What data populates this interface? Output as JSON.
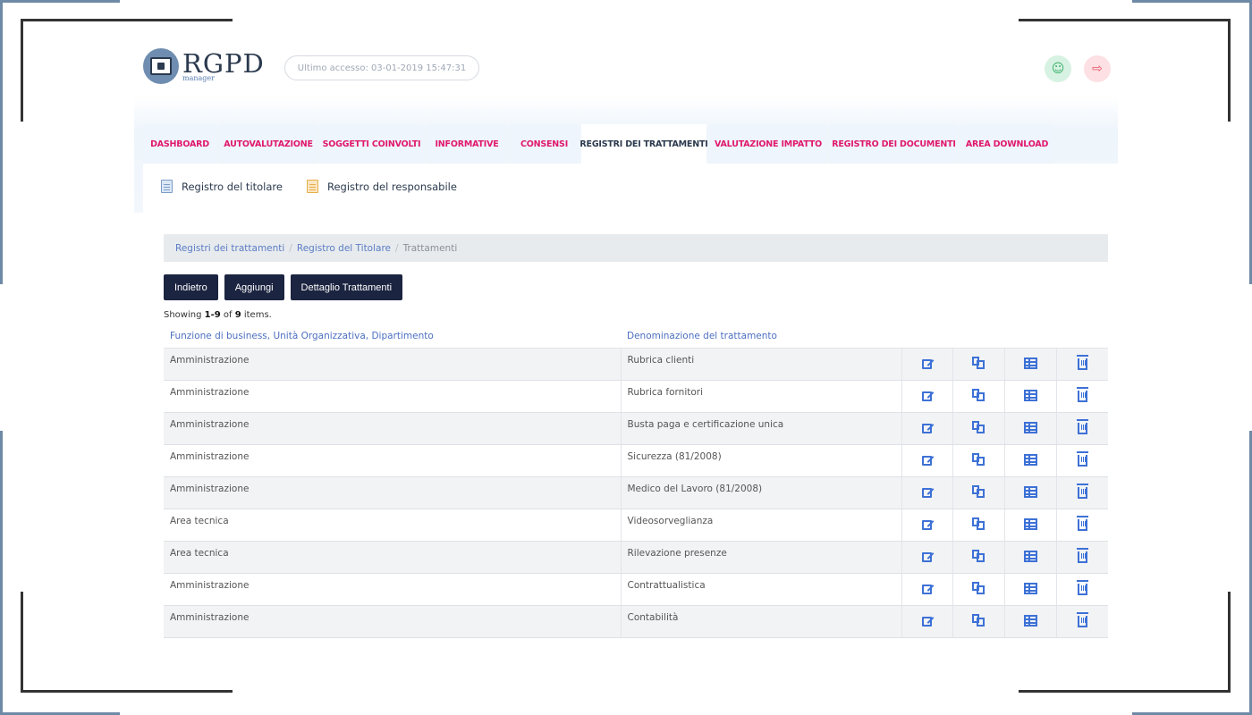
{
  "header": {
    "logo_text": "RGPD",
    "logo_sub": "manager",
    "last_access": "Ultimo accesso: 03-01-2019 15:47:31"
  },
  "tabs": [
    {
      "label": "DASHBOARD",
      "active": false
    },
    {
      "label": "AUTOVALUTAZIONE",
      "active": false
    },
    {
      "label": "SOGGETTI COINVOLTI",
      "active": false
    },
    {
      "label": "INFORMATIVE",
      "active": false
    },
    {
      "label": "CONSENSI",
      "active": false
    },
    {
      "label": "REGISTRI DEI TRATTAMENTI",
      "active": true
    },
    {
      "label": "VALUTAZIONE IMPATTO",
      "active": false
    },
    {
      "label": "REGISTRO DEI DOCUMENTI",
      "active": false
    },
    {
      "label": "AREA DOWNLOAD",
      "active": false
    }
  ],
  "subnav": {
    "titolare": "Registro del titolare",
    "responsabile": "Registro del responsabile"
  },
  "breadcrumb": {
    "level1": "Registri dei trattamenti",
    "level2": "Registro del Titolare",
    "current": "Trattamenti"
  },
  "buttons": {
    "back": "Indietro",
    "add": "Aggiungi",
    "detail": "Dettaglio Trattamenti"
  },
  "summary": {
    "prefix": "Showing ",
    "range": "1-9",
    "middle": " of ",
    "total": "9",
    "suffix": " items."
  },
  "table": {
    "columns": [
      "Funzione di business, Unità Organizzativa, Dipartimento",
      "Denominazione del trattamento"
    ],
    "rows": [
      [
        "Amministrazione",
        "Rubrica clienti"
      ],
      [
        "Amministrazione",
        "Rubrica fornitori"
      ],
      [
        "Amministrazione",
        "Busta paga e certificazione unica"
      ],
      [
        "Amministrazione",
        "Sicurezza (81/2008)"
      ],
      [
        "Amministrazione",
        "Medico del Lavoro (81/2008)"
      ],
      [
        "Area tecnica",
        "Videosorveglianza"
      ],
      [
        "Area tecnica",
        "Rilevazione presenze"
      ],
      [
        "Amministrazione",
        "Contrattualistica"
      ],
      [
        "Amministrazione",
        "Contabilità"
      ]
    ],
    "row_actions": [
      "edit-icon",
      "copy-icon",
      "table-icon",
      "trash-icon"
    ]
  },
  "colors": {
    "tab_text": "#e0186c",
    "button_bg": "#1b2440",
    "link": "#4c6fc0",
    "action_icon": "#3d71d6"
  }
}
